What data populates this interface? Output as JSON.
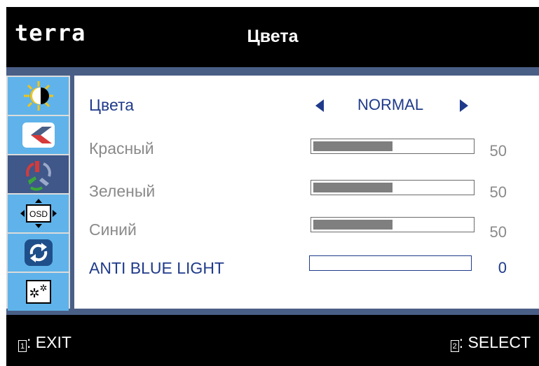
{
  "header": {
    "brand": "terra",
    "title": "Цвета"
  },
  "menu": {
    "icons": [
      "brightness-contrast-icon",
      "image-icon",
      "color-icon",
      "osd-icon",
      "reset-icon",
      "settings-icon"
    ],
    "selected_index": 2,
    "rows": [
      {
        "label": "Цвета",
        "kind": "selector",
        "value": "NORMAL",
        "active": true
      },
      {
        "label": "Красный",
        "kind": "slider",
        "value": "50",
        "level_percent": 50,
        "active": false
      },
      {
        "label": "Зеленый",
        "kind": "slider",
        "value": "50",
        "level_percent": 50,
        "active": false
      },
      {
        "label": "Синий",
        "kind": "slider",
        "value": "50",
        "level_percent": 50,
        "active": false
      },
      {
        "label": "ANTI BLUE LIGHT",
        "kind": "slider",
        "value": "0",
        "level_percent": 0,
        "active": true
      }
    ]
  },
  "footer": {
    "exit_key": "1",
    "exit_label": ": EXIT",
    "select_key": "2",
    "select_label": ": SELECT"
  },
  "colors": {
    "accent": "#5fb3ea",
    "selected": "#3f5789",
    "frame": "#4a5f86",
    "active_text": "#1f3a8a",
    "inactive_text": "#8a8a8a",
    "bar_fill": "#7f7f7f"
  }
}
